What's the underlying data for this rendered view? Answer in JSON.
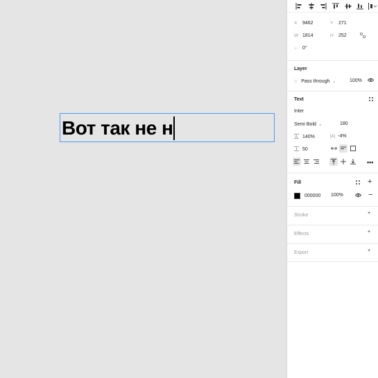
{
  "canvas": {
    "text_content": "Вот так не н"
  },
  "position": {
    "x_label": "X",
    "x_value": "9462",
    "y_label": "Y",
    "y_value": "271",
    "w_label": "W",
    "w_value": "1814",
    "h_label": "H",
    "h_value": "252",
    "rotation_value": "0°"
  },
  "layer": {
    "title": "Layer",
    "blend_mode": "Pass through",
    "opacity": "100%"
  },
  "text": {
    "title": "Text",
    "font_family": "Inter",
    "font_weight": "Semi Bold",
    "font_size": "180",
    "line_height": "140%",
    "letter_spacing": "-4%",
    "paragraph_spacing": "50"
  },
  "fill": {
    "title": "Fill",
    "color_hex": "000000",
    "opacity": "100%",
    "swatch_color": "#000000"
  },
  "stroke": {
    "title": "Stroke"
  },
  "effects": {
    "title": "Effects"
  },
  "export": {
    "title": "Export"
  },
  "colors": {
    "selection": "#4a9bf0",
    "canvas_bg": "#e5e5e5",
    "panel_bg": "#ffffff"
  }
}
